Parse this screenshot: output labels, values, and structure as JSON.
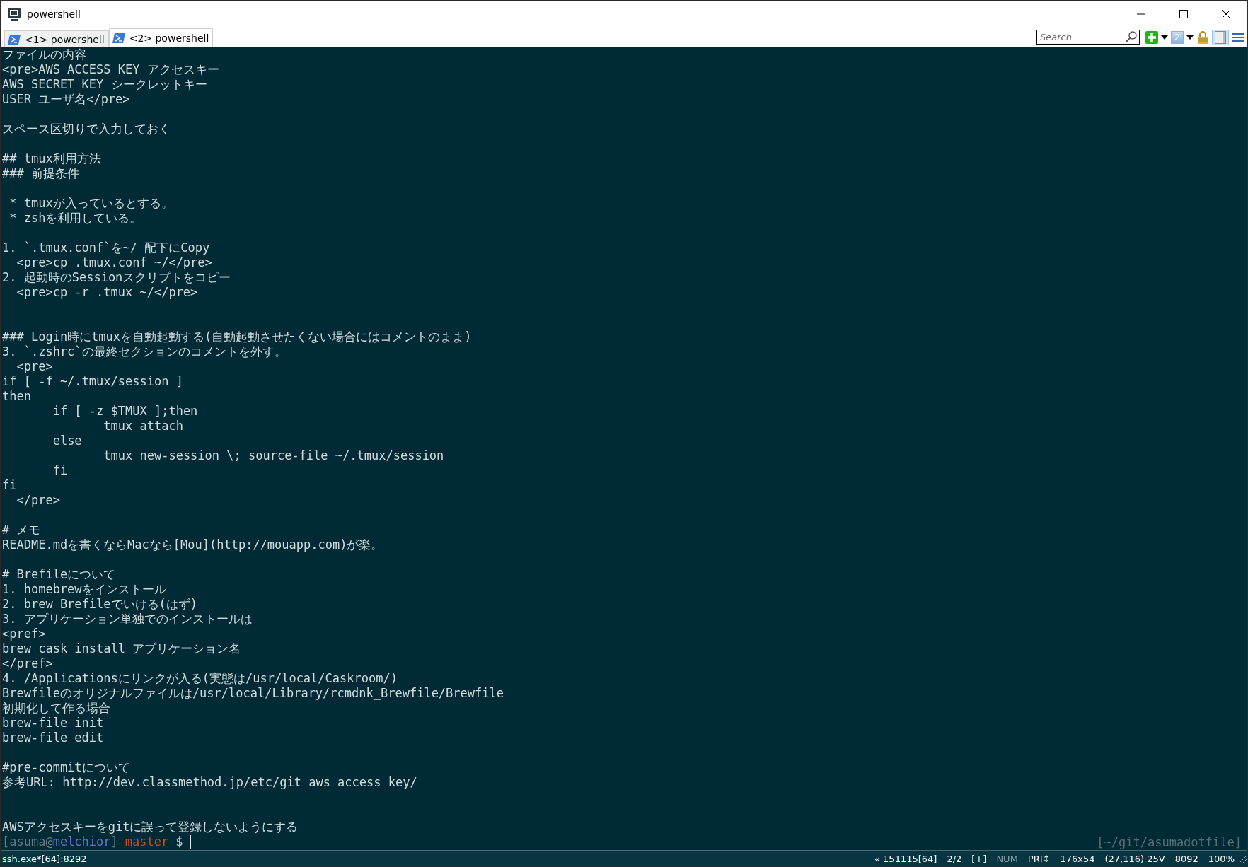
{
  "window": {
    "title": "powershell"
  },
  "tabs": [
    {
      "label": "<1> powershell",
      "selected": false
    },
    {
      "label": "<2> powershell",
      "selected": true
    }
  ],
  "toolbar": {
    "search": {
      "placeholder": "Search"
    },
    "console_count": "2",
    "split_pressed": true
  },
  "terminal": {
    "blocks": [
      {
        "kind": "first",
        "lines": [
          "ファイルの内容",
          "<pre>AWS_ACCESS_KEY アクセスキー",
          "AWS_SECRET_KEY シークレットキー",
          "USER ユーザ名</pre>"
        ]
      },
      {
        "kind": "para",
        "lines": [
          "スペース区切りで入力しておく"
        ]
      },
      {
        "kind": "para",
        "lines": [
          "## tmux利用方法",
          "### 前提条件"
        ]
      },
      {
        "kind": "para",
        "lines": [
          " * tmuxが入っているとする。",
          " * zshを利用している。"
        ]
      },
      {
        "kind": "para",
        "lines": [
          "1. `.tmux.conf`を~/ 配下にCopy",
          "  <pre>cp .tmux.conf ~/</pre>",
          "2. 起動時のSessionスクリプトをコピー",
          "  <pre>cp -r .tmux ~/</pre>"
        ]
      },
      {
        "kind": "wide",
        "lines": [
          "### Login時にtmuxを自動起動する(自動起動させたくない場合にはコメントのまま)",
          "3. `.zshrc`の最終セクションのコメントを外す。",
          "  <pre>",
          "if [ -f ~/.tmux/session ]",
          "then",
          "\tif [ -z $TMUX ];then",
          "\t\ttmux attach",
          "\telse",
          "\t\ttmux new-session \\; source-file ~/.tmux/session",
          "\tfi",
          "fi",
          "  </pre>"
        ]
      },
      {
        "kind": "para",
        "lines": [
          "# メモ",
          "README.mdを書くならMacなら[Mou](http://mouapp.com)が楽。"
        ]
      },
      {
        "kind": "para",
        "lines": [
          "# Brefileについて",
          "1. homebrewをインストール",
          "2. brew Brefileでいける(はず)",
          "3. アプリケーション単独でのインストールは",
          "<pref>",
          "brew cask install アプリケーション名",
          "</pref>",
          "4. /Applicationsにリンクが入る(実態は/usr/local/Caskroom/)",
          "Brewfileのオリジナルファイルは/usr/local/Library/rcmdnk_Brewfile/Brewfile",
          "初期化して作る場合",
          "brew-file init",
          "brew-file edit"
        ]
      },
      {
        "kind": "para",
        "lines": [
          "#pre-commitについて",
          "参考URL: http://dev.classmethod.jp/etc/git_aws_access_key/"
        ]
      },
      {
        "kind": "wide",
        "lines": [
          "AWSアクセスキーをgitに誤って登録しないようにする"
        ]
      }
    ],
    "prompt": [
      {
        "text": "[asuma@",
        "color": "#657b83",
        "kind": "user"
      },
      {
        "text": "melchior",
        "color": "#6c71c4",
        "kind": "host"
      },
      {
        "text": "]",
        "color": "#657b83",
        "kind": "bracket"
      },
      {
        "text": "master",
        "color": "#cb4b16",
        "kind": "branch"
      },
      {
        "text": "$",
        "color": "#b8c4c4",
        "kind": "symbol"
      }
    ],
    "cwd": "[~/git/asumadotfile]"
  },
  "status_bar": {
    "process": "ssh.exe*[64]:8292",
    "segments": [
      {
        "text": "« 151115[64]",
        "on": true
      },
      {
        "text": "2/2",
        "on": true
      },
      {
        "text": "[+]",
        "on": true
      },
      {
        "text": "NUM",
        "on": false
      },
      {
        "text": "PRI↕",
        "on": true
      },
      {
        "text": "176x54",
        "on": true
      },
      {
        "text": "(27,116) 25V",
        "on": true
      },
      {
        "text": "8092",
        "on": true
      },
      {
        "text": "100%",
        "on": true
      }
    ]
  }
}
